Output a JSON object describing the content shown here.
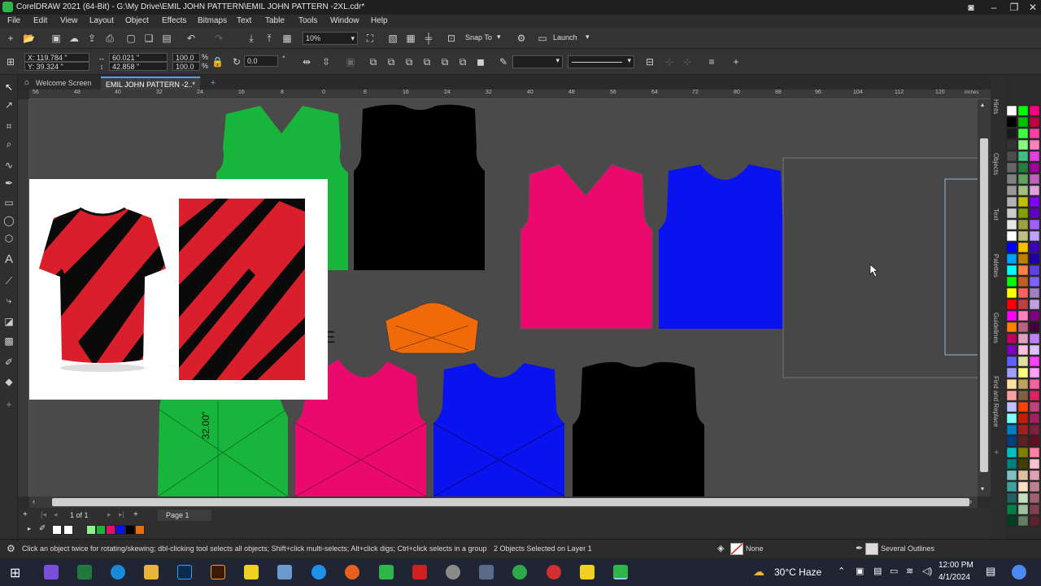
{
  "window": {
    "title": "CorelDRAW 2021 (64-Bit) - G:\\My Drive\\EMIL JOHN PATTERN\\EMIL JOHN PATTERN -2XL.cdr*"
  },
  "menu": [
    "File",
    "Edit",
    "View",
    "Layout",
    "Object",
    "Effects",
    "Bitmaps",
    "Text",
    "Table",
    "Tools",
    "Window",
    "Help"
  ],
  "toolbar": {
    "zoom": "10%",
    "snap_to": "Snap To",
    "launch": "Launch"
  },
  "properties": {
    "x": "X: 119.784 \"",
    "y": "Y: 39.324 \"",
    "width": "60.021 \"",
    "height": "42.858 \"",
    "scale_w": "100.0",
    "scale_h": "100.0",
    "pct1": "%",
    "pct2": "%",
    "rotation": "0.0",
    "degree": "°"
  },
  "tabs": {
    "welcome": "Welcome Screen",
    "document": "EMIL JOHN PATTERN -2..*"
  },
  "ruler": {
    "unit": "inches",
    "ticks": [
      "56",
      "48",
      "40",
      "32",
      "24",
      "16",
      "8",
      "0",
      "8",
      "16",
      "24",
      "32",
      "40",
      "48",
      "56",
      "64",
      "72",
      "80",
      "88",
      "96",
      "104",
      "112",
      "120"
    ]
  },
  "canvas": {
    "dimension_label": "32.00\"",
    "partial_letter": "E"
  },
  "dockers": [
    "Hints",
    "Objects",
    "Text",
    "Palettes",
    "Guidelines",
    "Find and Replace"
  ],
  "pagebar": {
    "page_count": "1 of 1",
    "page_tab": "Page 1"
  },
  "status": {
    "hint": "Click an object twice for rotating/skewing; dbl-clicking tool selects all objects; Shift+click multi-selects; Alt+click digs; Ctrl+click selects in a group",
    "selection": "2 Objects Selected on Layer 1",
    "fill": "None",
    "outline": "Several Outlines"
  },
  "taskbar": {
    "weather": "30°C  Haze",
    "time": "12:00 PM",
    "date": "4/1/2024"
  },
  "colors": {
    "green": "#18b53c",
    "black": "#000000",
    "pink": "#ea0a6e",
    "blue": "#0a12f0",
    "orange": "#f06a0a",
    "red_jersey": "#d81f2b"
  }
}
